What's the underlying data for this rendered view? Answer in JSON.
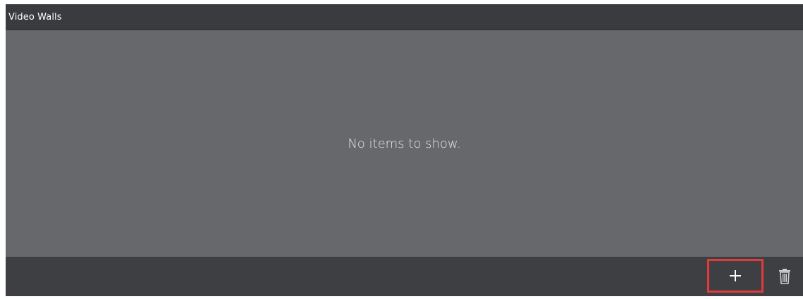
{
  "panel": {
    "title": "Video Walls",
    "empty_message": "No items to show."
  },
  "footer": {
    "buttons": [
      {
        "name": "add",
        "icon": "plus-icon"
      },
      {
        "name": "delete",
        "icon": "trash-icon"
      }
    ]
  },
  "colors": {
    "header_bg": "#3a3b3f",
    "content_bg": "#67686c",
    "footer_bg": "#3e3f43",
    "highlight": "#e03a3a"
  }
}
